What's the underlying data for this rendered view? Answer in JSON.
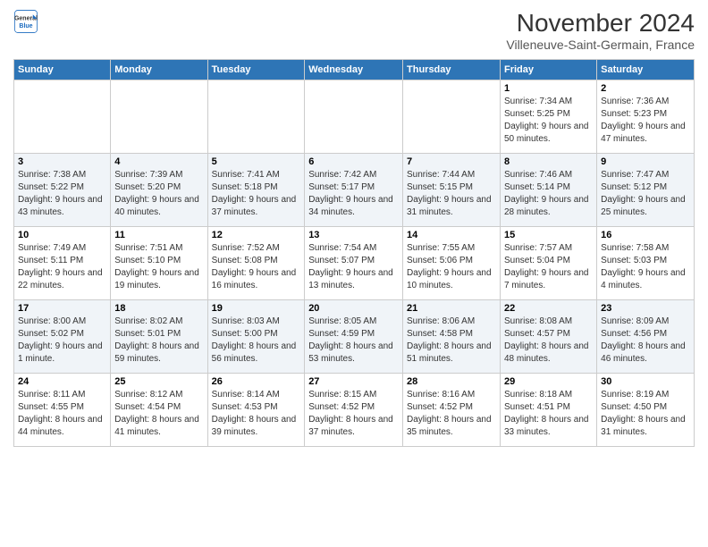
{
  "header": {
    "logo_line1": "General",
    "logo_line2": "Blue",
    "month": "November 2024",
    "location": "Villeneuve-Saint-Germain, France"
  },
  "days_of_week": [
    "Sunday",
    "Monday",
    "Tuesday",
    "Wednesday",
    "Thursday",
    "Friday",
    "Saturday"
  ],
  "weeks": [
    [
      {
        "day": "",
        "info": ""
      },
      {
        "day": "",
        "info": ""
      },
      {
        "day": "",
        "info": ""
      },
      {
        "day": "",
        "info": ""
      },
      {
        "day": "",
        "info": ""
      },
      {
        "day": "1",
        "info": "Sunrise: 7:34 AM\nSunset: 5:25 PM\nDaylight: 9 hours and 50 minutes."
      },
      {
        "day": "2",
        "info": "Sunrise: 7:36 AM\nSunset: 5:23 PM\nDaylight: 9 hours and 47 minutes."
      }
    ],
    [
      {
        "day": "3",
        "info": "Sunrise: 7:38 AM\nSunset: 5:22 PM\nDaylight: 9 hours and 43 minutes."
      },
      {
        "day": "4",
        "info": "Sunrise: 7:39 AM\nSunset: 5:20 PM\nDaylight: 9 hours and 40 minutes."
      },
      {
        "day": "5",
        "info": "Sunrise: 7:41 AM\nSunset: 5:18 PM\nDaylight: 9 hours and 37 minutes."
      },
      {
        "day": "6",
        "info": "Sunrise: 7:42 AM\nSunset: 5:17 PM\nDaylight: 9 hours and 34 minutes."
      },
      {
        "day": "7",
        "info": "Sunrise: 7:44 AM\nSunset: 5:15 PM\nDaylight: 9 hours and 31 minutes."
      },
      {
        "day": "8",
        "info": "Sunrise: 7:46 AM\nSunset: 5:14 PM\nDaylight: 9 hours and 28 minutes."
      },
      {
        "day": "9",
        "info": "Sunrise: 7:47 AM\nSunset: 5:12 PM\nDaylight: 9 hours and 25 minutes."
      }
    ],
    [
      {
        "day": "10",
        "info": "Sunrise: 7:49 AM\nSunset: 5:11 PM\nDaylight: 9 hours and 22 minutes."
      },
      {
        "day": "11",
        "info": "Sunrise: 7:51 AM\nSunset: 5:10 PM\nDaylight: 9 hours and 19 minutes."
      },
      {
        "day": "12",
        "info": "Sunrise: 7:52 AM\nSunset: 5:08 PM\nDaylight: 9 hours and 16 minutes."
      },
      {
        "day": "13",
        "info": "Sunrise: 7:54 AM\nSunset: 5:07 PM\nDaylight: 9 hours and 13 minutes."
      },
      {
        "day": "14",
        "info": "Sunrise: 7:55 AM\nSunset: 5:06 PM\nDaylight: 9 hours and 10 minutes."
      },
      {
        "day": "15",
        "info": "Sunrise: 7:57 AM\nSunset: 5:04 PM\nDaylight: 9 hours and 7 minutes."
      },
      {
        "day": "16",
        "info": "Sunrise: 7:58 AM\nSunset: 5:03 PM\nDaylight: 9 hours and 4 minutes."
      }
    ],
    [
      {
        "day": "17",
        "info": "Sunrise: 8:00 AM\nSunset: 5:02 PM\nDaylight: 9 hours and 1 minute."
      },
      {
        "day": "18",
        "info": "Sunrise: 8:02 AM\nSunset: 5:01 PM\nDaylight: 8 hours and 59 minutes."
      },
      {
        "day": "19",
        "info": "Sunrise: 8:03 AM\nSunset: 5:00 PM\nDaylight: 8 hours and 56 minutes."
      },
      {
        "day": "20",
        "info": "Sunrise: 8:05 AM\nSunset: 4:59 PM\nDaylight: 8 hours and 53 minutes."
      },
      {
        "day": "21",
        "info": "Sunrise: 8:06 AM\nSunset: 4:58 PM\nDaylight: 8 hours and 51 minutes."
      },
      {
        "day": "22",
        "info": "Sunrise: 8:08 AM\nSunset: 4:57 PM\nDaylight: 8 hours and 48 minutes."
      },
      {
        "day": "23",
        "info": "Sunrise: 8:09 AM\nSunset: 4:56 PM\nDaylight: 8 hours and 46 minutes."
      }
    ],
    [
      {
        "day": "24",
        "info": "Sunrise: 8:11 AM\nSunset: 4:55 PM\nDaylight: 8 hours and 44 minutes."
      },
      {
        "day": "25",
        "info": "Sunrise: 8:12 AM\nSunset: 4:54 PM\nDaylight: 8 hours and 41 minutes."
      },
      {
        "day": "26",
        "info": "Sunrise: 8:14 AM\nSunset: 4:53 PM\nDaylight: 8 hours and 39 minutes."
      },
      {
        "day": "27",
        "info": "Sunrise: 8:15 AM\nSunset: 4:52 PM\nDaylight: 8 hours and 37 minutes."
      },
      {
        "day": "28",
        "info": "Sunrise: 8:16 AM\nSunset: 4:52 PM\nDaylight: 8 hours and 35 minutes."
      },
      {
        "day": "29",
        "info": "Sunrise: 8:18 AM\nSunset: 4:51 PM\nDaylight: 8 hours and 33 minutes."
      },
      {
        "day": "30",
        "info": "Sunrise: 8:19 AM\nSunset: 4:50 PM\nDaylight: 8 hours and 31 minutes."
      }
    ]
  ]
}
